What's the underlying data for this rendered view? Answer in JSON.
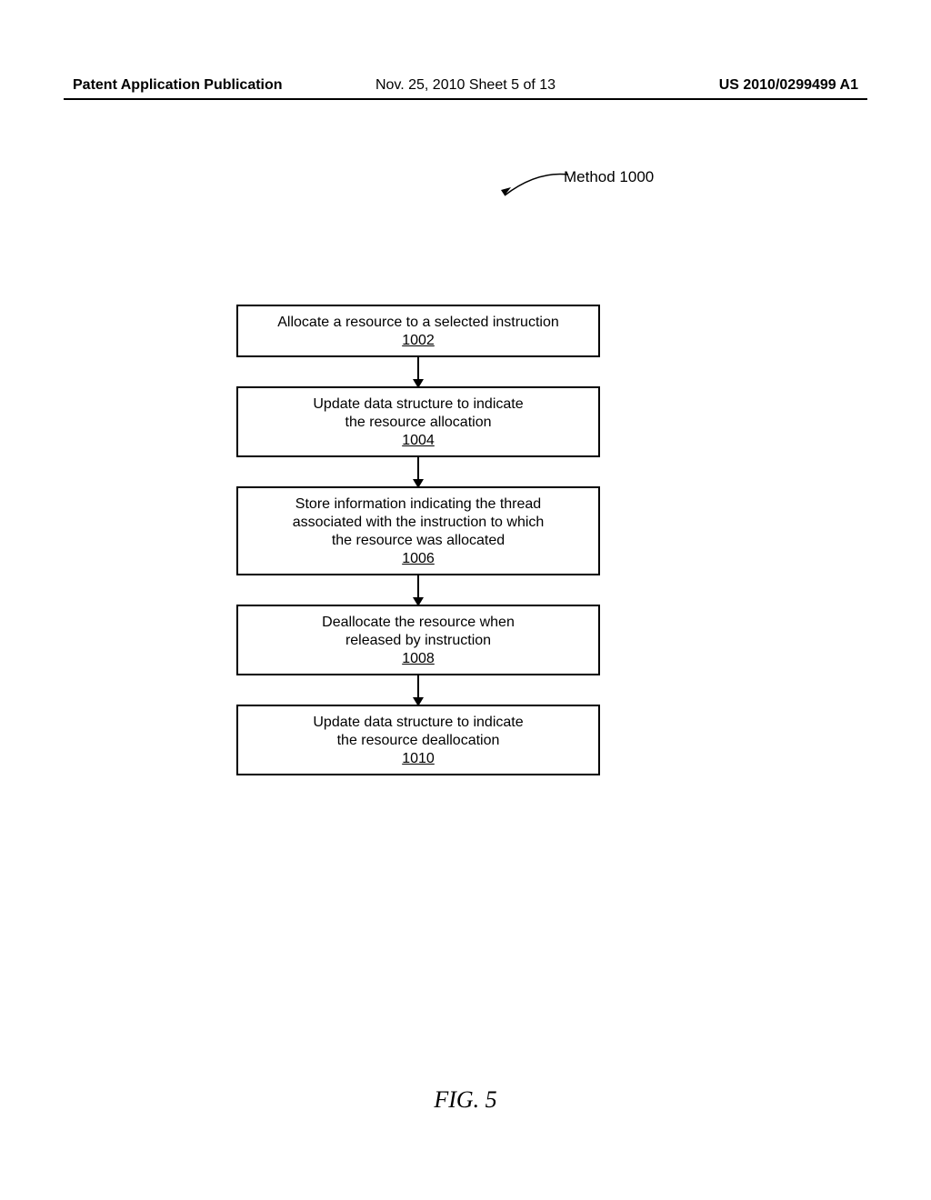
{
  "header": {
    "left": "Patent Application Publication",
    "center": "Nov. 25, 2010  Sheet 5 of 13",
    "right": "US 2010/0299499 A1"
  },
  "method_label": "Method 1000",
  "boxes": [
    {
      "text": "Allocate a resource to a selected instruction",
      "ref": "1002"
    },
    {
      "text": "Update data structure to indicate\nthe resource allocation",
      "ref": "1004"
    },
    {
      "text": "Store information indicating the thread\nassociated with the instruction to which\nthe resource was allocated",
      "ref": "1006"
    },
    {
      "text": "Deallocate the resource when\nreleased by instruction",
      "ref": "1008"
    },
    {
      "text": "Update data structure to indicate\nthe resource deallocation",
      "ref": "1010"
    }
  ],
  "figure_label": "FIG. 5"
}
